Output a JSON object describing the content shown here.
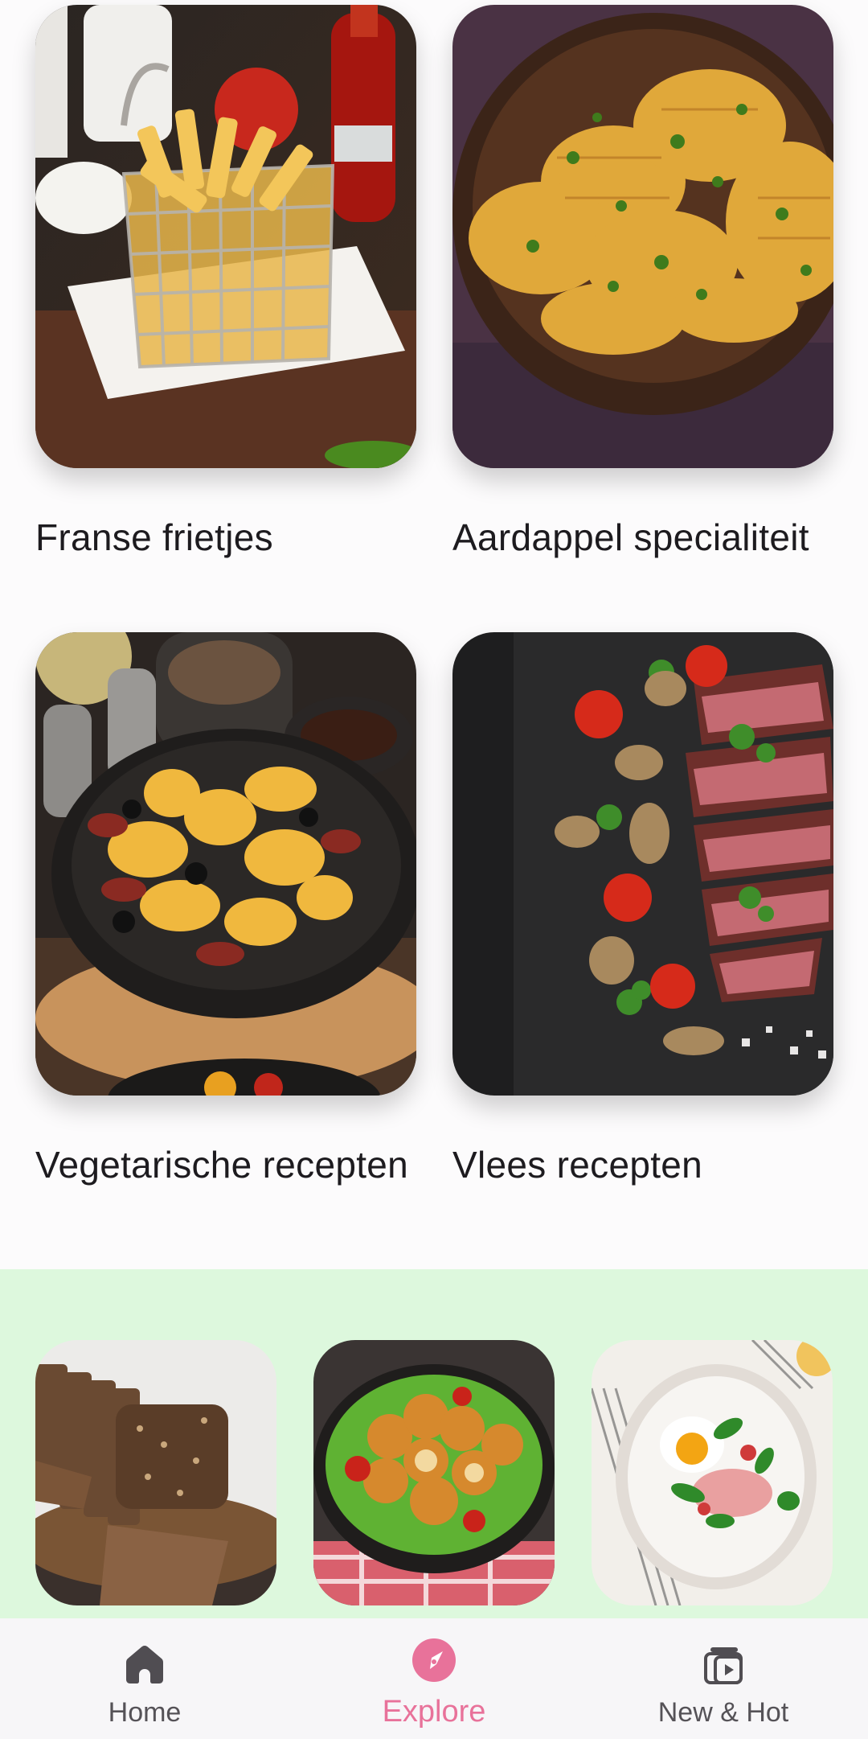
{
  "categories": [
    {
      "title": "Franse frietjes"
    },
    {
      "title": "Aardappel specialiteit"
    },
    {
      "title": "Vegetarische recepten"
    },
    {
      "title": "Vlees recepten"
    }
  ],
  "featured": [
    {
      "image": "bread-photo"
    },
    {
      "image": "croquettes-photo"
    },
    {
      "image": "breakfast-plate-photo"
    }
  ],
  "nav": {
    "items": [
      {
        "label": "Home",
        "icon": "home-icon"
      },
      {
        "label": "Explore",
        "icon": "compass-icon",
        "active": true
      },
      {
        "label": "New & Hot",
        "icon": "new-hot-icon"
      }
    ]
  },
  "colors": {
    "accent": "#e8729a",
    "band": "#ddf8dd",
    "background": "#fcfbfc",
    "nav_background": "#f7f6f8",
    "text": "#1d1b1f"
  }
}
